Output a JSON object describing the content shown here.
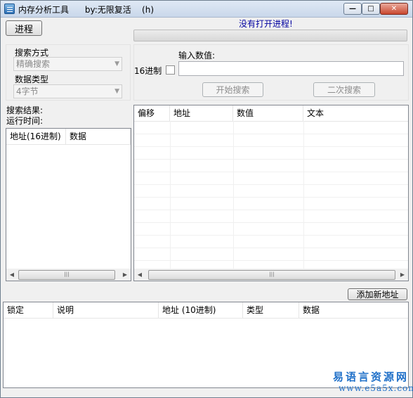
{
  "window": {
    "title": "内存分析工具      by:无限复活    (h)",
    "minimize": "—",
    "maximize": "□",
    "close": "✕"
  },
  "toolbar": {
    "process_button": "进程",
    "status": "没有打开进程!",
    "progress": 0
  },
  "search_settings": {
    "mode_label": "搜索方式",
    "mode_value": "精确搜索",
    "type_label": "数据类型",
    "type_value": "4字节"
  },
  "search_value": {
    "input_label": "输入数值:",
    "hex_label": "16进制",
    "hex_checked": false,
    "input_value": "",
    "start_button": "开始搜索",
    "second_button": "二次搜索"
  },
  "results": {
    "result_label": "搜索结果:",
    "runtime_label": "运行时间:"
  },
  "left_list": {
    "columns": [
      "地址(16进制)",
      "数据"
    ]
  },
  "right_list": {
    "columns": [
      "偏移",
      "地址",
      "数值",
      "文本"
    ]
  },
  "bottom": {
    "add_button": "添加新地址",
    "columns": [
      "锁定",
      "说明",
      "地址 (10进制)",
      "类型",
      "数据"
    ]
  },
  "watermark": {
    "cn": "易语言资源网",
    "url": "www.e5a5x.com"
  },
  "colors": {
    "status_text": "#0000a0",
    "watermark": "#1e6fc8",
    "progress_fill": "#06b025"
  }
}
